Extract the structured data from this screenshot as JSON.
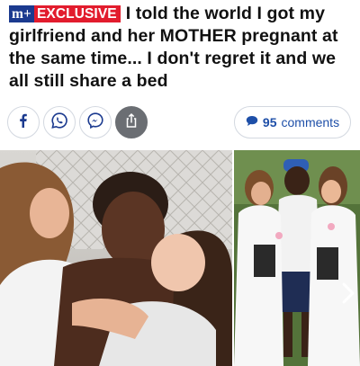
{
  "header": {
    "badge_mplus": "m+",
    "badge_exclusive": "EXCLUSIVE",
    "headline": "I told the world I got my girlfriend and her MOTHER pregnant at the same time... I don't regret it and we all still share a bed"
  },
  "share": {
    "icons": [
      "facebook-icon",
      "whatsapp-icon",
      "messenger-icon",
      "share-icon"
    ],
    "comments_count": "95",
    "comments_label": "comments"
  },
  "colors": {
    "brand_blue": "#1b3a8f",
    "exclusive_red": "#e21c2d",
    "link_blue": "#1e4fa8"
  }
}
